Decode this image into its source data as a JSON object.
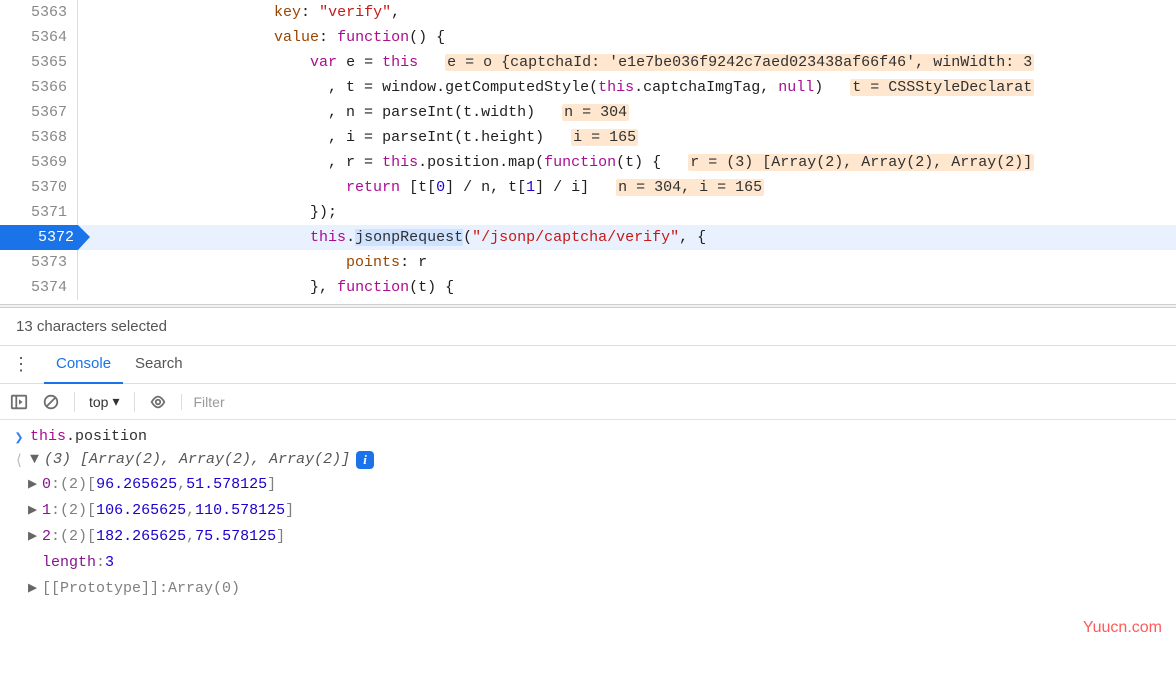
{
  "code": {
    "lines": [
      {
        "num": 5363,
        "indent": "                    ",
        "segs": [
          {
            "t": "key",
            "c": "key"
          },
          {
            "t": "pun",
            "c": ": "
          },
          {
            "t": "str",
            "c": "\"verify\""
          },
          {
            "t": "pun",
            "c": ","
          }
        ]
      },
      {
        "num": 5364,
        "indent": "                    ",
        "segs": [
          {
            "t": "key",
            "c": "value"
          },
          {
            "t": "pun",
            "c": ": "
          },
          {
            "t": "kw",
            "c": "function"
          },
          {
            "t": "pun",
            "c": "() {"
          }
        ]
      },
      {
        "num": 5365,
        "indent": "                        ",
        "segs": [
          {
            "t": "kw",
            "c": "var"
          },
          {
            "t": "pun",
            "c": " e = "
          },
          {
            "t": "kw",
            "c": "this"
          },
          {
            "t": "pun",
            "c": "   "
          },
          {
            "t": "hl",
            "c": "e = o {captchaId: 'e1e7be036f9242c7aed023438af66f46', winWidth: 3"
          }
        ]
      },
      {
        "num": 5366,
        "indent": "                          ",
        "segs": [
          {
            "t": "pun",
            "c": ", t = "
          },
          {
            "t": "ident",
            "c": "window"
          },
          {
            "t": "pun",
            "c": "."
          },
          {
            "t": "ident",
            "c": "getComputedStyle"
          },
          {
            "t": "pun",
            "c": "("
          },
          {
            "t": "kw",
            "c": "this"
          },
          {
            "t": "pun",
            "c": "."
          },
          {
            "t": "ident",
            "c": "captchaImgTag"
          },
          {
            "t": "pun",
            "c": ", "
          },
          {
            "t": "kw",
            "c": "null"
          },
          {
            "t": "pun",
            "c": ")   "
          },
          {
            "t": "hl",
            "c": "t = CSSStyleDeclarat"
          }
        ]
      },
      {
        "num": 5367,
        "indent": "                          ",
        "segs": [
          {
            "t": "pun",
            "c": ", n = "
          },
          {
            "t": "ident",
            "c": "parseInt"
          },
          {
            "t": "pun",
            "c": "(t."
          },
          {
            "t": "ident",
            "c": "width"
          },
          {
            "t": "pun",
            "c": ")   "
          },
          {
            "t": "hl",
            "c": "n = 304"
          }
        ]
      },
      {
        "num": 5368,
        "indent": "                          ",
        "segs": [
          {
            "t": "pun",
            "c": ", i = "
          },
          {
            "t": "ident",
            "c": "parseInt"
          },
          {
            "t": "pun",
            "c": "(t."
          },
          {
            "t": "ident",
            "c": "height"
          },
          {
            "t": "pun",
            "c": ")   "
          },
          {
            "t": "hl",
            "c": "i = 165"
          }
        ]
      },
      {
        "num": 5369,
        "indent": "                          ",
        "segs": [
          {
            "t": "pun",
            "c": ", r = "
          },
          {
            "t": "kw",
            "c": "this"
          },
          {
            "t": "pun",
            "c": "."
          },
          {
            "t": "ident",
            "c": "position"
          },
          {
            "t": "pun",
            "c": "."
          },
          {
            "t": "ident",
            "c": "map"
          },
          {
            "t": "pun",
            "c": "("
          },
          {
            "t": "kw",
            "c": "function"
          },
          {
            "t": "pun",
            "c": "(t) {   "
          },
          {
            "t": "hl",
            "c": "r = (3) [Array(2), Array(2), Array(2)]"
          }
        ]
      },
      {
        "num": 5370,
        "indent": "                            ",
        "segs": [
          {
            "t": "kw",
            "c": "return"
          },
          {
            "t": "pun",
            "c": " [t["
          },
          {
            "t": "num",
            "c": "0"
          },
          {
            "t": "pun",
            "c": "] / n, t["
          },
          {
            "t": "num",
            "c": "1"
          },
          {
            "t": "pun",
            "c": "] / i]   "
          },
          {
            "t": "hl",
            "c": "n = 304, i = 165"
          }
        ]
      },
      {
        "num": 5371,
        "indent": "                        ",
        "segs": [
          {
            "t": "pun",
            "c": "});"
          }
        ]
      },
      {
        "num": 5372,
        "bp": true,
        "indent": "                        ",
        "segs": [
          {
            "t": "kw",
            "c": "this"
          },
          {
            "t": "pun",
            "c": "."
          },
          {
            "t": "sel",
            "c": "jsonpRequest"
          },
          {
            "t": "pun",
            "c": "("
          },
          {
            "t": "str",
            "c": "\"/jsonp/captcha/verify\""
          },
          {
            "t": "pun",
            "c": ", {"
          }
        ]
      },
      {
        "num": 5373,
        "indent": "                            ",
        "segs": [
          {
            "t": "key",
            "c": "points"
          },
          {
            "t": "pun",
            "c": ": r"
          }
        ]
      },
      {
        "num": 5374,
        "indent": "                        ",
        "segs": [
          {
            "t": "pun",
            "c": "}, "
          },
          {
            "t": "kw",
            "c": "function"
          },
          {
            "t": "pun",
            "c": "(t) {"
          }
        ]
      }
    ]
  },
  "status": {
    "text": "13 characters selected"
  },
  "tabs": {
    "console": "Console",
    "search": "Search"
  },
  "toolbar": {
    "context": "top",
    "filter_placeholder": "Filter"
  },
  "console": {
    "input": {
      "prefix": "this",
      "prop": "position"
    },
    "summary": {
      "len": "(3)",
      "preview": "[Array(2), Array(2), Array(2)]"
    },
    "rows": [
      {
        "idx": "0",
        "len": "(2)",
        "a": "96.265625",
        "b": "51.578125"
      },
      {
        "idx": "1",
        "len": "(2)",
        "a": "106.265625",
        "b": "110.578125"
      },
      {
        "idx": "2",
        "len": "(2)",
        "a": "182.265625",
        "b": "75.578125"
      }
    ],
    "length_label": "length",
    "length_value": "3",
    "proto_label": "[[Prototype]]",
    "proto_value": "Array(0)"
  },
  "watermark": "Yuucn.com"
}
